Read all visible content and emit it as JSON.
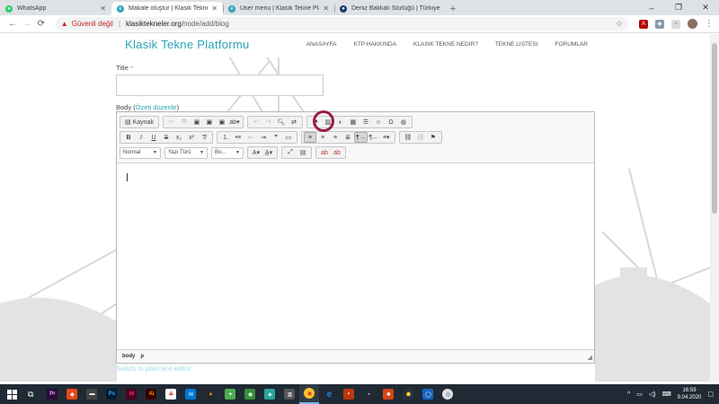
{
  "browser": {
    "tabs": [
      {
        "title": "WhatsApp",
        "favicon_color": "#25d366",
        "active": false,
        "closeable": true
      },
      {
        "title": "Makale oluştur | Klasik Tekne Platformu",
        "favicon_color": "#2aa3b8",
        "active": true,
        "closeable": true
      },
      {
        "title": "User menu | Klasik Tekne Platformu",
        "favicon_color": "#2aa3b8",
        "active": false,
        "closeable": true
      },
      {
        "title": "Deniz Bakkalı Sözlüğü | Türkiye",
        "favicon_color": "#1a3a6b",
        "active": false,
        "closeable": false
      }
    ],
    "new_tab_label": "+",
    "window_controls": [
      "–",
      "❐",
      "✕"
    ],
    "address": {
      "security_label": "Güvenli değil",
      "separator": "|",
      "host": "klasiktekneler.org",
      "path": "/node/add/blog"
    }
  },
  "site": {
    "logo": "Klasik Tekne Platformu",
    "nav": [
      "ANASAYFA",
      "KTP HAKKINDA",
      "KLASIK TEKNE NEDIR?",
      "TEKNE LISTESI",
      "FORUMLAR"
    ]
  },
  "form": {
    "title_label": "Title",
    "required_mark": "*",
    "title_value": "",
    "body_label": "Body (",
    "summary_link": "Özeti düzenle",
    "body_label_close": ")",
    "editor": {
      "source_label": "Kaynak",
      "format_combo": "Normal",
      "font_combo": "Yazı Türü",
      "size_combo": "Bo...",
      "status_path": [
        "body",
        "p"
      ]
    },
    "plain_text_link": "Switch to plain text editor"
  },
  "taskbar": {
    "clock_time": "16:59",
    "clock_date": "9.04.2020",
    "tray_expand": "^"
  }
}
